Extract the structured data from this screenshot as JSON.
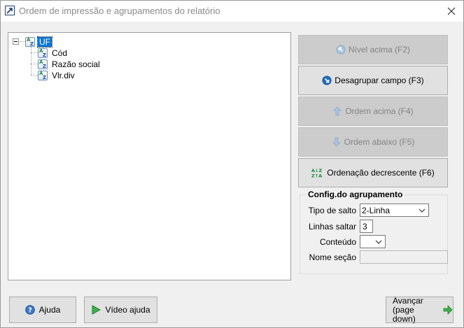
{
  "window": {
    "title": "Ordem de impressão e agrupamentos do relatório"
  },
  "tree": {
    "root": {
      "label": "UF",
      "selected": true
    },
    "children": [
      {
        "label": "Cód"
      },
      {
        "label": "Razão social"
      },
      {
        "label": "Vlr.div"
      }
    ]
  },
  "actions": {
    "nivel_acima": {
      "label": "Nível acima (F2)",
      "enabled": false
    },
    "desagrupar": {
      "label": "Desagrupar campo (F3)",
      "enabled": true
    },
    "ordem_acima": {
      "label": "Ordem acima (F4)",
      "enabled": false
    },
    "ordem_abaixo": {
      "label": "Ordem abaixo (F5)",
      "enabled": false
    },
    "ordenacao": {
      "label": "Ordenação decrescente (F6)",
      "enabled": true
    }
  },
  "config": {
    "legend": "Config.do agrupamento",
    "tipo_salto_label": "Tipo de salto",
    "tipo_salto_value": "2-Linha",
    "linhas_saltar_label": "Linhas saltar",
    "linhas_saltar_value": "3",
    "conteudo_label": "Conteúdo",
    "conteudo_value": "",
    "nome_secao_label": "Nome seção",
    "nome_secao_value": ""
  },
  "footer": {
    "ajuda": "Ajuda",
    "video_ajuda": "Vídeo ajuda",
    "avancar_line1": "Avançar",
    "avancar_line2": "(page down)"
  },
  "colors": {
    "selection": "#0078d7",
    "disabled_button": "#cccccc",
    "button": "#e1e1e1"
  }
}
